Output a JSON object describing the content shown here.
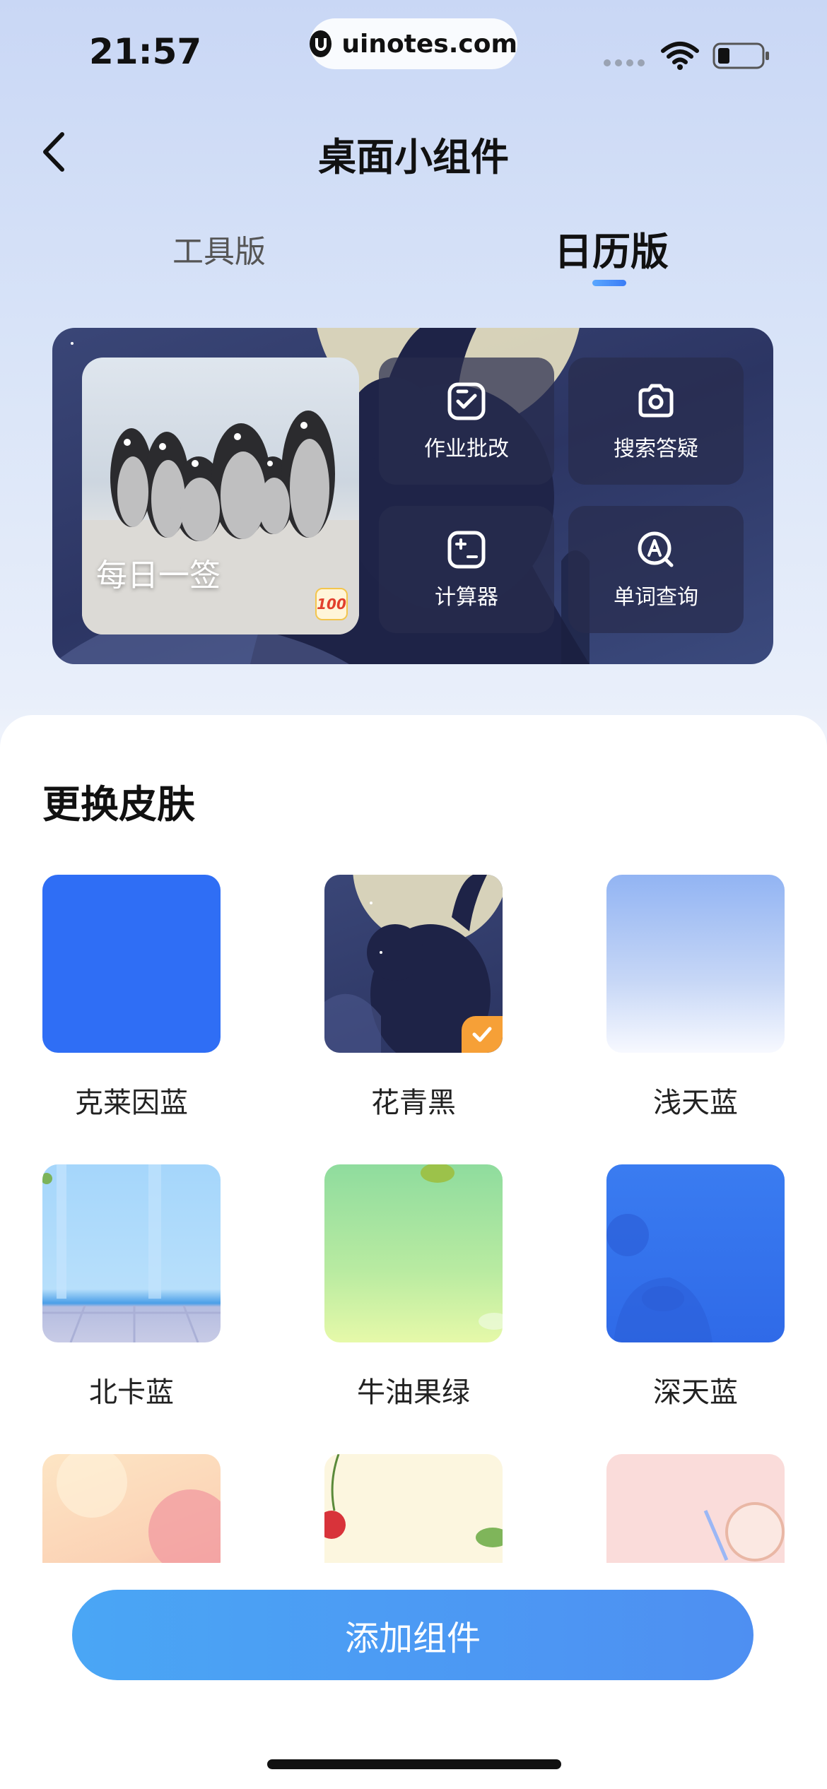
{
  "status_bar": {
    "time": "21:57",
    "url": "uinotes.com",
    "icons": [
      "signal-icon",
      "wifi-icon",
      "battery-icon"
    ]
  },
  "header": {
    "title": "桌面小组件",
    "back_icon": "chevron-left-icon"
  },
  "tabs": [
    {
      "label": "工具版",
      "active": false
    },
    {
      "label": "日历版",
      "active": true
    }
  ],
  "preview": {
    "daily_label": "每日一签",
    "badge": "100",
    "tools": [
      {
        "label": "作业批改",
        "icon": "homework-check-icon"
      },
      {
        "label": "搜索答疑",
        "icon": "camera-icon"
      },
      {
        "label": "计算器",
        "icon": "calculator-icon"
      },
      {
        "label": "单词查询",
        "icon": "word-search-icon"
      }
    ]
  },
  "skins": {
    "title": "更换皮肤",
    "items": [
      {
        "label": "克莱因蓝",
        "selected": false
      },
      {
        "label": "花青黑",
        "selected": true
      },
      {
        "label": "浅天蓝",
        "selected": false
      },
      {
        "label": "北卡蓝",
        "selected": false
      },
      {
        "label": "牛油果绿",
        "selected": false
      },
      {
        "label": "深天蓝",
        "selected": false
      },
      {
        "label": "",
        "selected": false
      },
      {
        "label": "",
        "selected": false
      },
      {
        "label": "",
        "selected": false
      }
    ]
  },
  "footer": {
    "add_button_label": "添加组件"
  },
  "colors": {
    "accent": "#4a9af4",
    "selected_badge": "#f6a037",
    "klein_blue": "#2f6ef5"
  }
}
